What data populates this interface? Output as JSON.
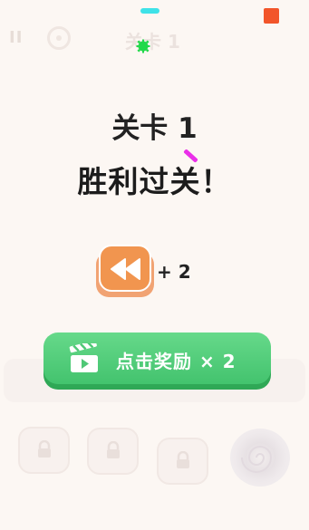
{
  "hud": {
    "level_label": "关卡 1",
    "pause_glyph": "II"
  },
  "result": {
    "level_title": "关卡 1",
    "status_text": "胜利过关！"
  },
  "reward": {
    "rewind_count": "+ 2"
  },
  "claim_button": {
    "label": "点击奖励 × 2"
  },
  "colors": {
    "background": "#fcf7f3",
    "rewind_orange": "#f1954f",
    "claim_green": "#4fc876",
    "corner_red": "#f2552a",
    "cyan_piece": "#3ee2e8",
    "green_piece": "#22d94a",
    "pink_piece": "#ea2fe9"
  },
  "icons": [
    "pause-icon",
    "restart-icon",
    "rewind-icon",
    "film-clapper-icon",
    "lock-icon",
    "vortex-icon"
  ]
}
